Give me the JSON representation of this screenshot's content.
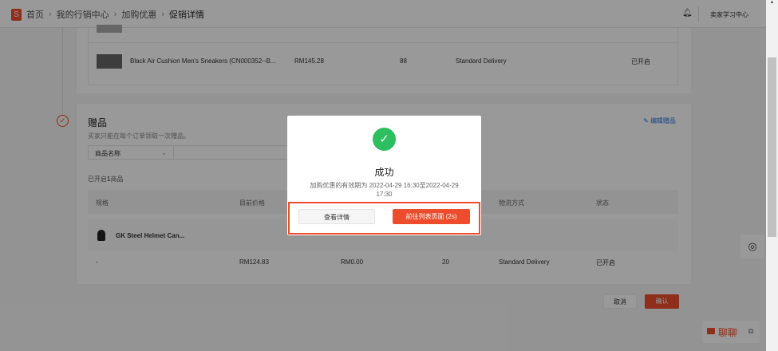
{
  "breadcrumb": {
    "logo": "S",
    "items": [
      "首页",
      "我的行销中心",
      "加购优惠"
    ],
    "current": "促销详情"
  },
  "header": {
    "learning_center": "卖家学习中心"
  },
  "top_product": {
    "name": "Black Air Cushion Men's Sneakers (CN000352--B...",
    "price": "RM145.28",
    "stock": "88",
    "shipping": "Standard Delivery",
    "status": "已开启"
  },
  "gift": {
    "title": "赠品",
    "subtitle": "买家只能在每个订单领取一次赠品。",
    "edit_label": "编辑赠品",
    "filter_select": "商品名称",
    "count_prefix": "已开启",
    "count": "1",
    "count_suffix": "商品",
    "columns": [
      "规格",
      "目前价格",
      "物流方式",
      "状态"
    ],
    "product_name": "GK Steel Helmet Can...",
    "row": {
      "spec": "-",
      "current_price": "RM124.83",
      "gift_price": "RM0.00",
      "stock": "20",
      "shipping": "Standard Delivery",
      "status": "已开启"
    }
  },
  "footer": {
    "cancel": "取消",
    "confirm": "确认"
  },
  "chat": {
    "label": "聊聊"
  },
  "modal": {
    "title": "成功",
    "message": "加购优惠的有效期为 2022-04-29 16:30至2022-04-29 17:30",
    "view_details": "查看详情",
    "go_list": "前往列表页面 (2s)"
  },
  "colors": {
    "brand": "#ee4d2d",
    "success": "#2dbe60",
    "link": "#2673dd"
  }
}
